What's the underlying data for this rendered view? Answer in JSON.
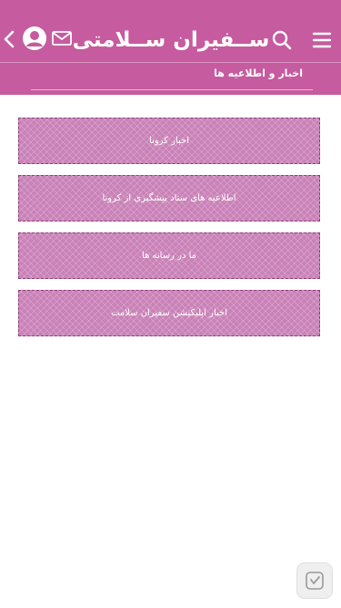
{
  "header": {
    "logo_text": "ســفیران ســلامتی",
    "subtitle": "اخبار و اطلاعیه ها",
    "icons": [
      "chevron-left-icon",
      "user-avatar-icon",
      "mail-icon",
      "search-icon",
      "hamburger-menu-icon"
    ]
  },
  "cards": [
    {
      "label": "اخبار کرونا"
    },
    {
      "label": "اطلاعیه های ستاد پیشگیری از کرونا"
    },
    {
      "label": "ما در رسانه ها"
    },
    {
      "label": "اخبار اپلیکیشن سفیران سلامت"
    }
  ],
  "colors": {
    "primary": "#c65b9f",
    "card": "#c981b7",
    "card_border": "#8b3f78"
  }
}
